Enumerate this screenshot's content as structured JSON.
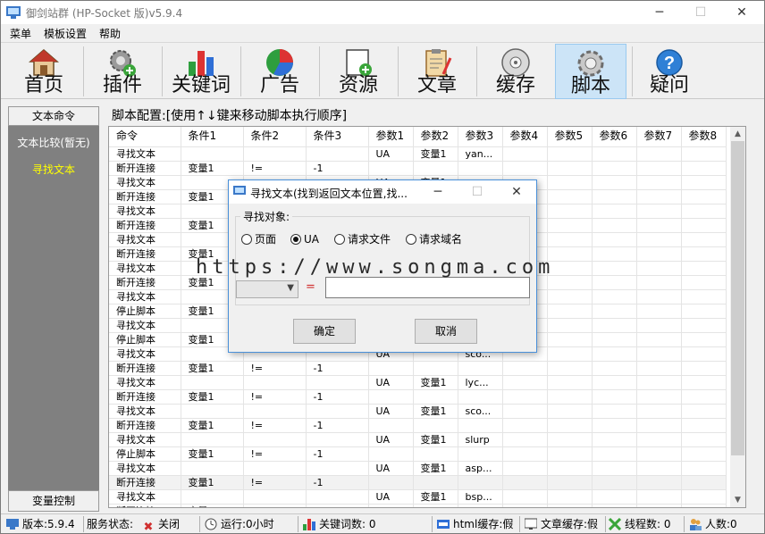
{
  "window": {
    "title": "御剑站群 (HP-Socket 版)v5.9.4",
    "minimize": "─",
    "maximize": "☐",
    "close": "✕"
  },
  "menu": [
    "菜单",
    "模板设置",
    "帮助"
  ],
  "toolbar": [
    {
      "label": "首页",
      "icon": "home-icon"
    },
    {
      "label": "插件",
      "icon": "plugin-gear-icon"
    },
    {
      "label": "关键词",
      "icon": "bar-chart-icon"
    },
    {
      "label": "广告",
      "icon": "pie-chart-icon"
    },
    {
      "label": "资源",
      "icon": "add-resource-icon"
    },
    {
      "label": "文章",
      "icon": "clipboard-icon"
    },
    {
      "label": "缓存",
      "icon": "disc-icon"
    },
    {
      "label": "脚本",
      "icon": "gear-icon",
      "active": true
    },
    {
      "label": "疑问",
      "icon": "help-icon"
    }
  ],
  "left": {
    "header": "文本命令",
    "items": [
      "文本比较(暂无)",
      "寻找文本"
    ],
    "footer": "变量控制"
  },
  "config_label": "脚本配置:[使用↑↓键来移动脚本执行顺序]",
  "grid": {
    "columns": [
      "命令",
      "条件1",
      "条件2",
      "条件3",
      "参数1",
      "参数2",
      "参数3",
      "参数4",
      "参数5",
      "参数6",
      "参数7",
      "参数8"
    ],
    "rows": [
      [
        "寻找文本",
        "",
        "",
        "",
        "UA",
        "变量1",
        "yan..."
      ],
      [
        "断开连接",
        "变量1",
        "!=",
        "-1",
        "",
        "",
        ""
      ],
      [
        "寻找文本",
        "",
        "",
        "",
        "UA",
        "变量1",
        ""
      ],
      [
        "断开连接",
        "变量1",
        "",
        "",
        "",
        "",
        ""
      ],
      [
        "寻找文本",
        "",
        "",
        "",
        "",
        "",
        ""
      ],
      [
        "断开连接",
        "变量1",
        "",
        "",
        "",
        "",
        ""
      ],
      [
        "寻找文本",
        "",
        "",
        "",
        "",
        "",
        ""
      ],
      [
        "断开连接",
        "变量1",
        "",
        "",
        "",
        "",
        ""
      ],
      [
        "寻找文本",
        "",
        "",
        "",
        "",
        "",
        ""
      ],
      [
        "断开连接",
        "变量1",
        "",
        "",
        "",
        "",
        ""
      ],
      [
        "寻找文本",
        "",
        "",
        "",
        "",
        "",
        ""
      ],
      [
        "停止脚本",
        "变量1",
        "",
        "",
        "",
        "",
        ""
      ],
      [
        "寻找文本",
        "",
        "",
        "",
        "",
        "",
        ""
      ],
      [
        "停止脚本",
        "变量1",
        "",
        "",
        "",
        "",
        ""
      ],
      [
        "寻找文本",
        "",
        "",
        "",
        "UA",
        "",
        "sco..."
      ],
      [
        "断开连接",
        "变量1",
        "!=",
        "-1",
        "",
        "",
        ""
      ],
      [
        "寻找文本",
        "",
        "",
        "",
        "UA",
        "变量1",
        "lyc..."
      ],
      [
        "断开连接",
        "变量1",
        "!=",
        "-1",
        "",
        "",
        ""
      ],
      [
        "寻找文本",
        "",
        "",
        "",
        "UA",
        "变量1",
        "sco..."
      ],
      [
        "断开连接",
        "变量1",
        "!=",
        "-1",
        "",
        "",
        ""
      ],
      [
        "寻找文本",
        "",
        "",
        "",
        "UA",
        "变量1",
        "slurp"
      ],
      [
        "停止脚本",
        "变量1",
        "!=",
        "-1",
        "",
        "",
        ""
      ],
      [
        "寻找文本",
        "",
        "",
        "",
        "UA",
        "变量1",
        "asp..."
      ],
      [
        "断开连接",
        "变量1",
        "!=",
        "-1",
        "",
        "",
        ""
      ],
      [
        "寻找文本",
        "",
        "",
        "",
        "UA",
        "变量1",
        "bsp..."
      ],
      [
        "断开连接",
        "变量1",
        "",
        "",
        "",
        "",
        ""
      ]
    ],
    "highlight_row": 23
  },
  "dialog": {
    "title": "寻找文本(找到返回文本位置,找...",
    "group_label": "寻找对象:",
    "options": [
      {
        "label": "页面",
        "selected": false
      },
      {
        "label": "UA",
        "selected": true
      },
      {
        "label": "请求文件",
        "selected": false
      },
      {
        "label": "请求域名",
        "selected": false
      }
    ],
    "equals": "=",
    "ok": "确定",
    "cancel": "取消"
  },
  "status": {
    "version": "版本:5.9.4",
    "service": "服务状态:",
    "service_state": "关闭",
    "runtime": "运行:0小时",
    "keywords": "关键词数: 0",
    "html_cache": "html缓存:假",
    "article_cache": "文章缓存:假",
    "threads": "线程数: 0",
    "people": "人数:0"
  },
  "watermark": "https://www.songma.com",
  "colors": {
    "active_tab": "#cce4f7",
    "left_selected": "#ffff00",
    "close_red": "#d03030"
  }
}
